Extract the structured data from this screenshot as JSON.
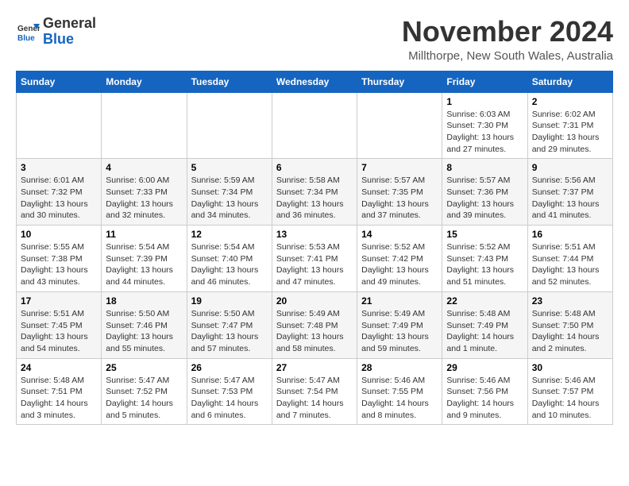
{
  "logo": {
    "general": "General",
    "blue": "Blue"
  },
  "title": "November 2024",
  "subtitle": "Millthorpe, New South Wales, Australia",
  "days_of_week": [
    "Sunday",
    "Monday",
    "Tuesday",
    "Wednesday",
    "Thursday",
    "Friday",
    "Saturday"
  ],
  "weeks": [
    [
      {
        "day": "",
        "info": ""
      },
      {
        "day": "",
        "info": ""
      },
      {
        "day": "",
        "info": ""
      },
      {
        "day": "",
        "info": ""
      },
      {
        "day": "",
        "info": ""
      },
      {
        "day": "1",
        "info": "Sunrise: 6:03 AM\nSunset: 7:30 PM\nDaylight: 13 hours\nand 27 minutes."
      },
      {
        "day": "2",
        "info": "Sunrise: 6:02 AM\nSunset: 7:31 PM\nDaylight: 13 hours\nand 29 minutes."
      }
    ],
    [
      {
        "day": "3",
        "info": "Sunrise: 6:01 AM\nSunset: 7:32 PM\nDaylight: 13 hours\nand 30 minutes."
      },
      {
        "day": "4",
        "info": "Sunrise: 6:00 AM\nSunset: 7:33 PM\nDaylight: 13 hours\nand 32 minutes."
      },
      {
        "day": "5",
        "info": "Sunrise: 5:59 AM\nSunset: 7:34 PM\nDaylight: 13 hours\nand 34 minutes."
      },
      {
        "day": "6",
        "info": "Sunrise: 5:58 AM\nSunset: 7:34 PM\nDaylight: 13 hours\nand 36 minutes."
      },
      {
        "day": "7",
        "info": "Sunrise: 5:57 AM\nSunset: 7:35 PM\nDaylight: 13 hours\nand 37 minutes."
      },
      {
        "day": "8",
        "info": "Sunrise: 5:57 AM\nSunset: 7:36 PM\nDaylight: 13 hours\nand 39 minutes."
      },
      {
        "day": "9",
        "info": "Sunrise: 5:56 AM\nSunset: 7:37 PM\nDaylight: 13 hours\nand 41 minutes."
      }
    ],
    [
      {
        "day": "10",
        "info": "Sunrise: 5:55 AM\nSunset: 7:38 PM\nDaylight: 13 hours\nand 43 minutes."
      },
      {
        "day": "11",
        "info": "Sunrise: 5:54 AM\nSunset: 7:39 PM\nDaylight: 13 hours\nand 44 minutes."
      },
      {
        "day": "12",
        "info": "Sunrise: 5:54 AM\nSunset: 7:40 PM\nDaylight: 13 hours\nand 46 minutes."
      },
      {
        "day": "13",
        "info": "Sunrise: 5:53 AM\nSunset: 7:41 PM\nDaylight: 13 hours\nand 47 minutes."
      },
      {
        "day": "14",
        "info": "Sunrise: 5:52 AM\nSunset: 7:42 PM\nDaylight: 13 hours\nand 49 minutes."
      },
      {
        "day": "15",
        "info": "Sunrise: 5:52 AM\nSunset: 7:43 PM\nDaylight: 13 hours\nand 51 minutes."
      },
      {
        "day": "16",
        "info": "Sunrise: 5:51 AM\nSunset: 7:44 PM\nDaylight: 13 hours\nand 52 minutes."
      }
    ],
    [
      {
        "day": "17",
        "info": "Sunrise: 5:51 AM\nSunset: 7:45 PM\nDaylight: 13 hours\nand 54 minutes."
      },
      {
        "day": "18",
        "info": "Sunrise: 5:50 AM\nSunset: 7:46 PM\nDaylight: 13 hours\nand 55 minutes."
      },
      {
        "day": "19",
        "info": "Sunrise: 5:50 AM\nSunset: 7:47 PM\nDaylight: 13 hours\nand 57 minutes."
      },
      {
        "day": "20",
        "info": "Sunrise: 5:49 AM\nSunset: 7:48 PM\nDaylight: 13 hours\nand 58 minutes."
      },
      {
        "day": "21",
        "info": "Sunrise: 5:49 AM\nSunset: 7:49 PM\nDaylight: 13 hours\nand 59 minutes."
      },
      {
        "day": "22",
        "info": "Sunrise: 5:48 AM\nSunset: 7:49 PM\nDaylight: 14 hours\nand 1 minute."
      },
      {
        "day": "23",
        "info": "Sunrise: 5:48 AM\nSunset: 7:50 PM\nDaylight: 14 hours\nand 2 minutes."
      }
    ],
    [
      {
        "day": "24",
        "info": "Sunrise: 5:48 AM\nSunset: 7:51 PM\nDaylight: 14 hours\nand 3 minutes."
      },
      {
        "day": "25",
        "info": "Sunrise: 5:47 AM\nSunset: 7:52 PM\nDaylight: 14 hours\nand 5 minutes."
      },
      {
        "day": "26",
        "info": "Sunrise: 5:47 AM\nSunset: 7:53 PM\nDaylight: 14 hours\nand 6 minutes."
      },
      {
        "day": "27",
        "info": "Sunrise: 5:47 AM\nSunset: 7:54 PM\nDaylight: 14 hours\nand 7 minutes."
      },
      {
        "day": "28",
        "info": "Sunrise: 5:46 AM\nSunset: 7:55 PM\nDaylight: 14 hours\nand 8 minutes."
      },
      {
        "day": "29",
        "info": "Sunrise: 5:46 AM\nSunset: 7:56 PM\nDaylight: 14 hours\nand 9 minutes."
      },
      {
        "day": "30",
        "info": "Sunrise: 5:46 AM\nSunset: 7:57 PM\nDaylight: 14 hours\nand 10 minutes."
      }
    ]
  ]
}
